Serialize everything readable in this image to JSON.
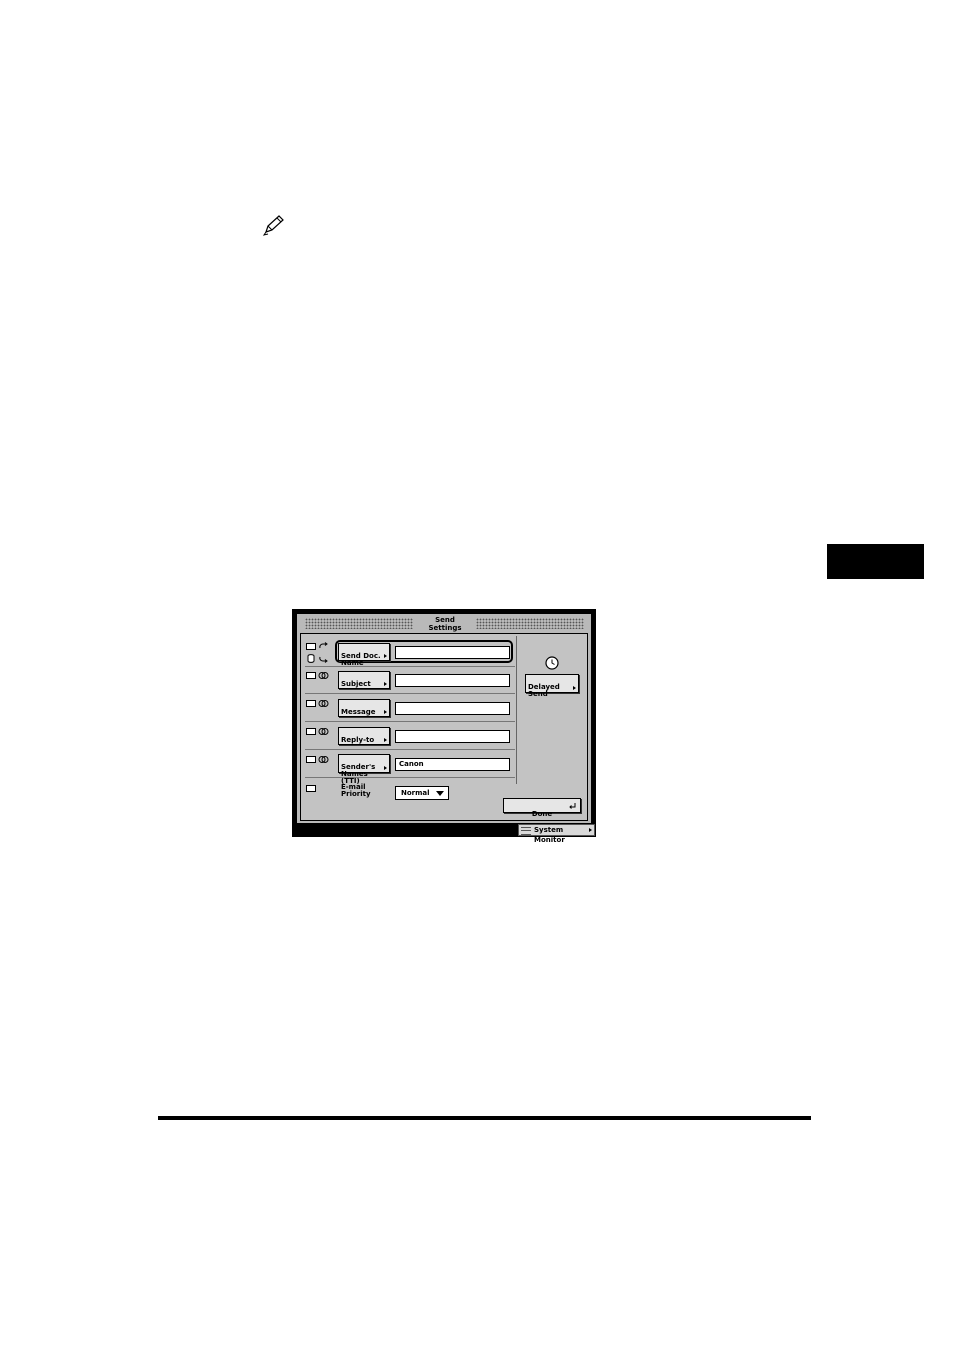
{
  "panel": {
    "title": "Send\nSettings",
    "rows": [
      {
        "button": "Send Doc.\nName",
        "value": ""
      },
      {
        "button": "Subject",
        "value": ""
      },
      {
        "button": "Message",
        "value": ""
      },
      {
        "button": "Reply-to",
        "value": ""
      },
      {
        "button": "Sender's\nNames (TTI)",
        "value": "Canon"
      }
    ],
    "email_priority": {
      "label": "E-mail\nPriority",
      "selected": "Normal"
    },
    "delayed_send_label": "Delayed\nSend",
    "done_label": "Done"
  },
  "status_bar": {
    "system_monitor_label": "System Monitor"
  }
}
